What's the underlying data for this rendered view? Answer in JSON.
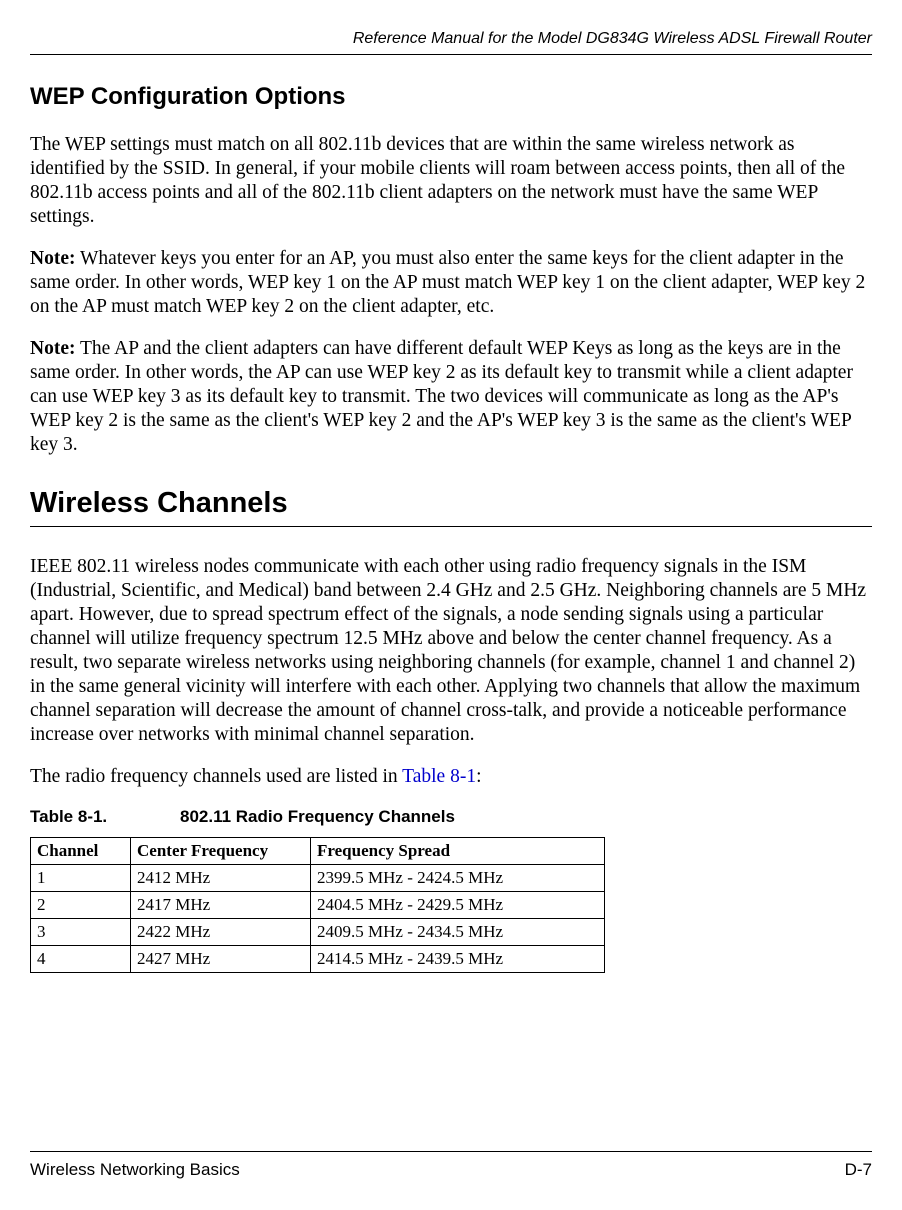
{
  "header": {
    "title": "Reference Manual for the Model DG834G Wireless ADSL Firewall Router"
  },
  "section1": {
    "title": "WEP Configuration Options",
    "para1": "The WEP settings must match on all 802.11b devices that are within the same wireless network as identified by the SSID. In general, if your mobile clients will roam between access points, then all of the 802.11b access points and all of the 802.11b client adapters on the network must have the same WEP settings.",
    "note1_label": "Note:",
    "note1_text": " Whatever keys you enter for an AP, you must also enter the same keys for the client adapter in the same order. In other words, WEP key 1 on the AP must match WEP key 1 on the client adapter, WEP key 2 on the AP must match WEP key 2 on the client adapter, etc.",
    "note2_label": "Note:",
    "note2_text": " The AP and the client adapters can have different default WEP Keys as long as the keys are in the same order. In other words, the AP can use WEP key 2 as its default key to transmit while a client adapter can use WEP key 3 as its default key to transmit. The two devices will communicate as long as the AP's WEP key 2 is the same as the client's WEP key 2 and the AP's WEP key 3 is the same as the client's WEP key 3."
  },
  "section2": {
    "title": "Wireless Channels",
    "para1": "IEEE 802.11 wireless nodes communicate with each other using radio frequency signals in the ISM (Industrial, Scientific, and Medical) band between 2.4 GHz and 2.5 GHz. Neighboring channels are 5 MHz apart. However, due to spread spectrum effect of the signals, a node sending signals using a particular channel will utilize frequency spectrum 12.5 MHz above and below the center channel frequency. As a result, two separate wireless networks using neighboring channels (for example, channel 1 and channel 2) in the same general vicinity will interfere with each other. Applying two channels that allow the maximum channel separation will decrease the amount of channel cross-talk, and provide a noticeable performance increase over networks with minimal channel separation.",
    "para2_pre": "The radio frequency channels used are listed in ",
    "para2_link": "Table 8-1",
    "para2_post": ":"
  },
  "table": {
    "caption_num": "Table 8-1.",
    "caption_title": "802.11 Radio Frequency Channels",
    "headers": {
      "channel": "Channel",
      "center": "Center Frequency",
      "spread": "Frequency Spread"
    },
    "rows": [
      {
        "channel": "1",
        "center": "2412 MHz",
        "spread": "2399.5 MHz - 2424.5 MHz"
      },
      {
        "channel": "2",
        "center": "2417 MHz",
        "spread": "2404.5 MHz - 2429.5 MHz"
      },
      {
        "channel": "3",
        "center": "2422 MHz",
        "spread": "2409.5 MHz - 2434.5 MHz"
      },
      {
        "channel": "4",
        "center": "2427 MHz",
        "spread": "2414.5 MHz - 2439.5 MHz"
      }
    ]
  },
  "footer": {
    "left": "Wireless Networking Basics",
    "right": "D-7"
  }
}
